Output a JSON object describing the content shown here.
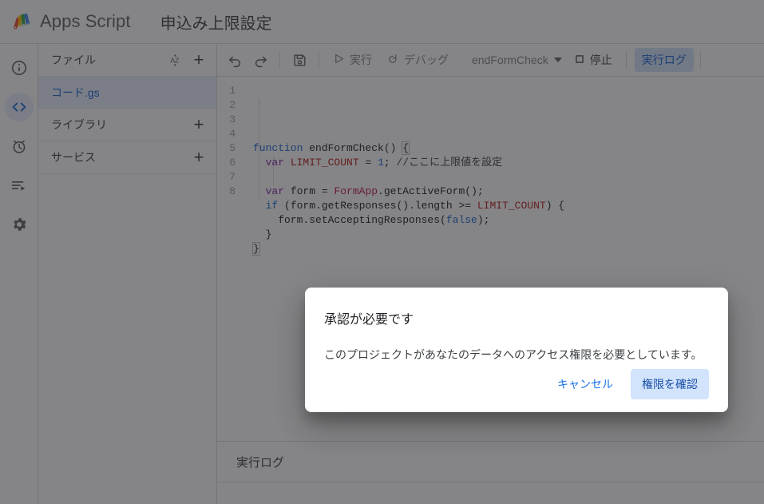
{
  "header": {
    "logo_icon": "apps-script-logo",
    "product_name": "Apps Script",
    "project_title": "申込み上限設定"
  },
  "nav_rail": {
    "items": [
      {
        "icon": "info-icon",
        "name": "overview",
        "active": false
      },
      {
        "icon": "code-icon",
        "name": "editor",
        "active": true
      },
      {
        "icon": "alarm-clock-icon",
        "name": "triggers",
        "active": false
      },
      {
        "icon": "executions-icon",
        "name": "executions",
        "active": false
      },
      {
        "icon": "gear-icon",
        "name": "settings",
        "active": false
      }
    ]
  },
  "sidebar": {
    "files_label": "ファイル",
    "sort_icon": "sort-az-icon",
    "add_file_icon": "plus-icon",
    "file_items": [
      {
        "name": "コード.gs",
        "selected": true
      }
    ],
    "libraries_label": "ライブラリ",
    "add_library_icon": "plus-icon",
    "services_label": "サービス",
    "add_service_icon": "plus-icon"
  },
  "toolbar": {
    "undo_icon": "undo-icon",
    "redo_icon": "redo-icon",
    "save_icon": "save-floppy-icon",
    "run_label": "実行",
    "run_icon": "play-icon",
    "debug_label": "デバッグ",
    "debug_icon": "debug-icon",
    "function_selected": "endFormCheck",
    "function_caret_icon": "chevron-down-icon",
    "stop_label": "停止",
    "stop_icon": "stop-square-icon",
    "execution_log_label": "実行ログ"
  },
  "editor": {
    "line_numbers": [
      "1",
      "2",
      "3",
      "4",
      "5",
      "6",
      "7",
      "8"
    ],
    "lines": [
      [
        {
          "t": "function ",
          "c": "tok-kw"
        },
        {
          "t": "endFormCheck",
          "c": "tok-plain"
        },
        {
          "t": "() ",
          "c": "tok-plain"
        },
        {
          "t": "{",
          "c": "tok-plain brace-match"
        }
      ],
      [
        {
          "t": "  ",
          "c": "tok-plain"
        },
        {
          "t": "var ",
          "c": "tok-var"
        },
        {
          "t": "LIMIT_COUNT",
          "c": "tok-const"
        },
        {
          "t": " = ",
          "c": "tok-plain"
        },
        {
          "t": "1",
          "c": "tok-num"
        },
        {
          "t": "; ",
          "c": "tok-plain"
        },
        {
          "t": "//ここに上限値を設定",
          "c": "tok-comment"
        }
      ],
      [],
      [
        {
          "t": "  ",
          "c": "tok-plain"
        },
        {
          "t": "var ",
          "c": "tok-var"
        },
        {
          "t": "form = ",
          "c": "tok-plain"
        },
        {
          "t": "FormApp",
          "c": "tok-type"
        },
        {
          "t": ".getActiveForm();",
          "c": "tok-plain"
        }
      ],
      [
        {
          "t": "  ",
          "c": "tok-plain"
        },
        {
          "t": "if ",
          "c": "tok-kw"
        },
        {
          "t": "(form.getResponses().length >= ",
          "c": "tok-plain"
        },
        {
          "t": "LIMIT_COUNT",
          "c": "tok-const"
        },
        {
          "t": ") {",
          "c": "tok-plain"
        }
      ],
      [
        {
          "t": "    form.setAcceptingResponses(",
          "c": "tok-plain"
        },
        {
          "t": "false",
          "c": "tok-bool"
        },
        {
          "t": ");",
          "c": "tok-plain"
        }
      ],
      [
        {
          "t": "  }",
          "c": "tok-plain"
        }
      ],
      [
        {
          "t": "}",
          "c": "tok-plain brace-match"
        }
      ]
    ]
  },
  "log_panel": {
    "title": "実行ログ"
  },
  "dialog": {
    "title": "承認が必要です",
    "message": "このプロジェクトがあなたのデータへのアクセス権限を必要としています。",
    "cancel_label": "キャンセル",
    "confirm_label": "権限を確認"
  },
  "colors": {
    "accent_blue": "#1a73e8",
    "accent_blue_dark": "#174ea6",
    "selected_bg": "#e8f0fe",
    "pill_bg": "#d2e3fc",
    "text_primary": "#202124",
    "text_secondary": "#5f6368",
    "border": "#dadce0",
    "scrim": "rgba(32,33,36,0.55)"
  }
}
